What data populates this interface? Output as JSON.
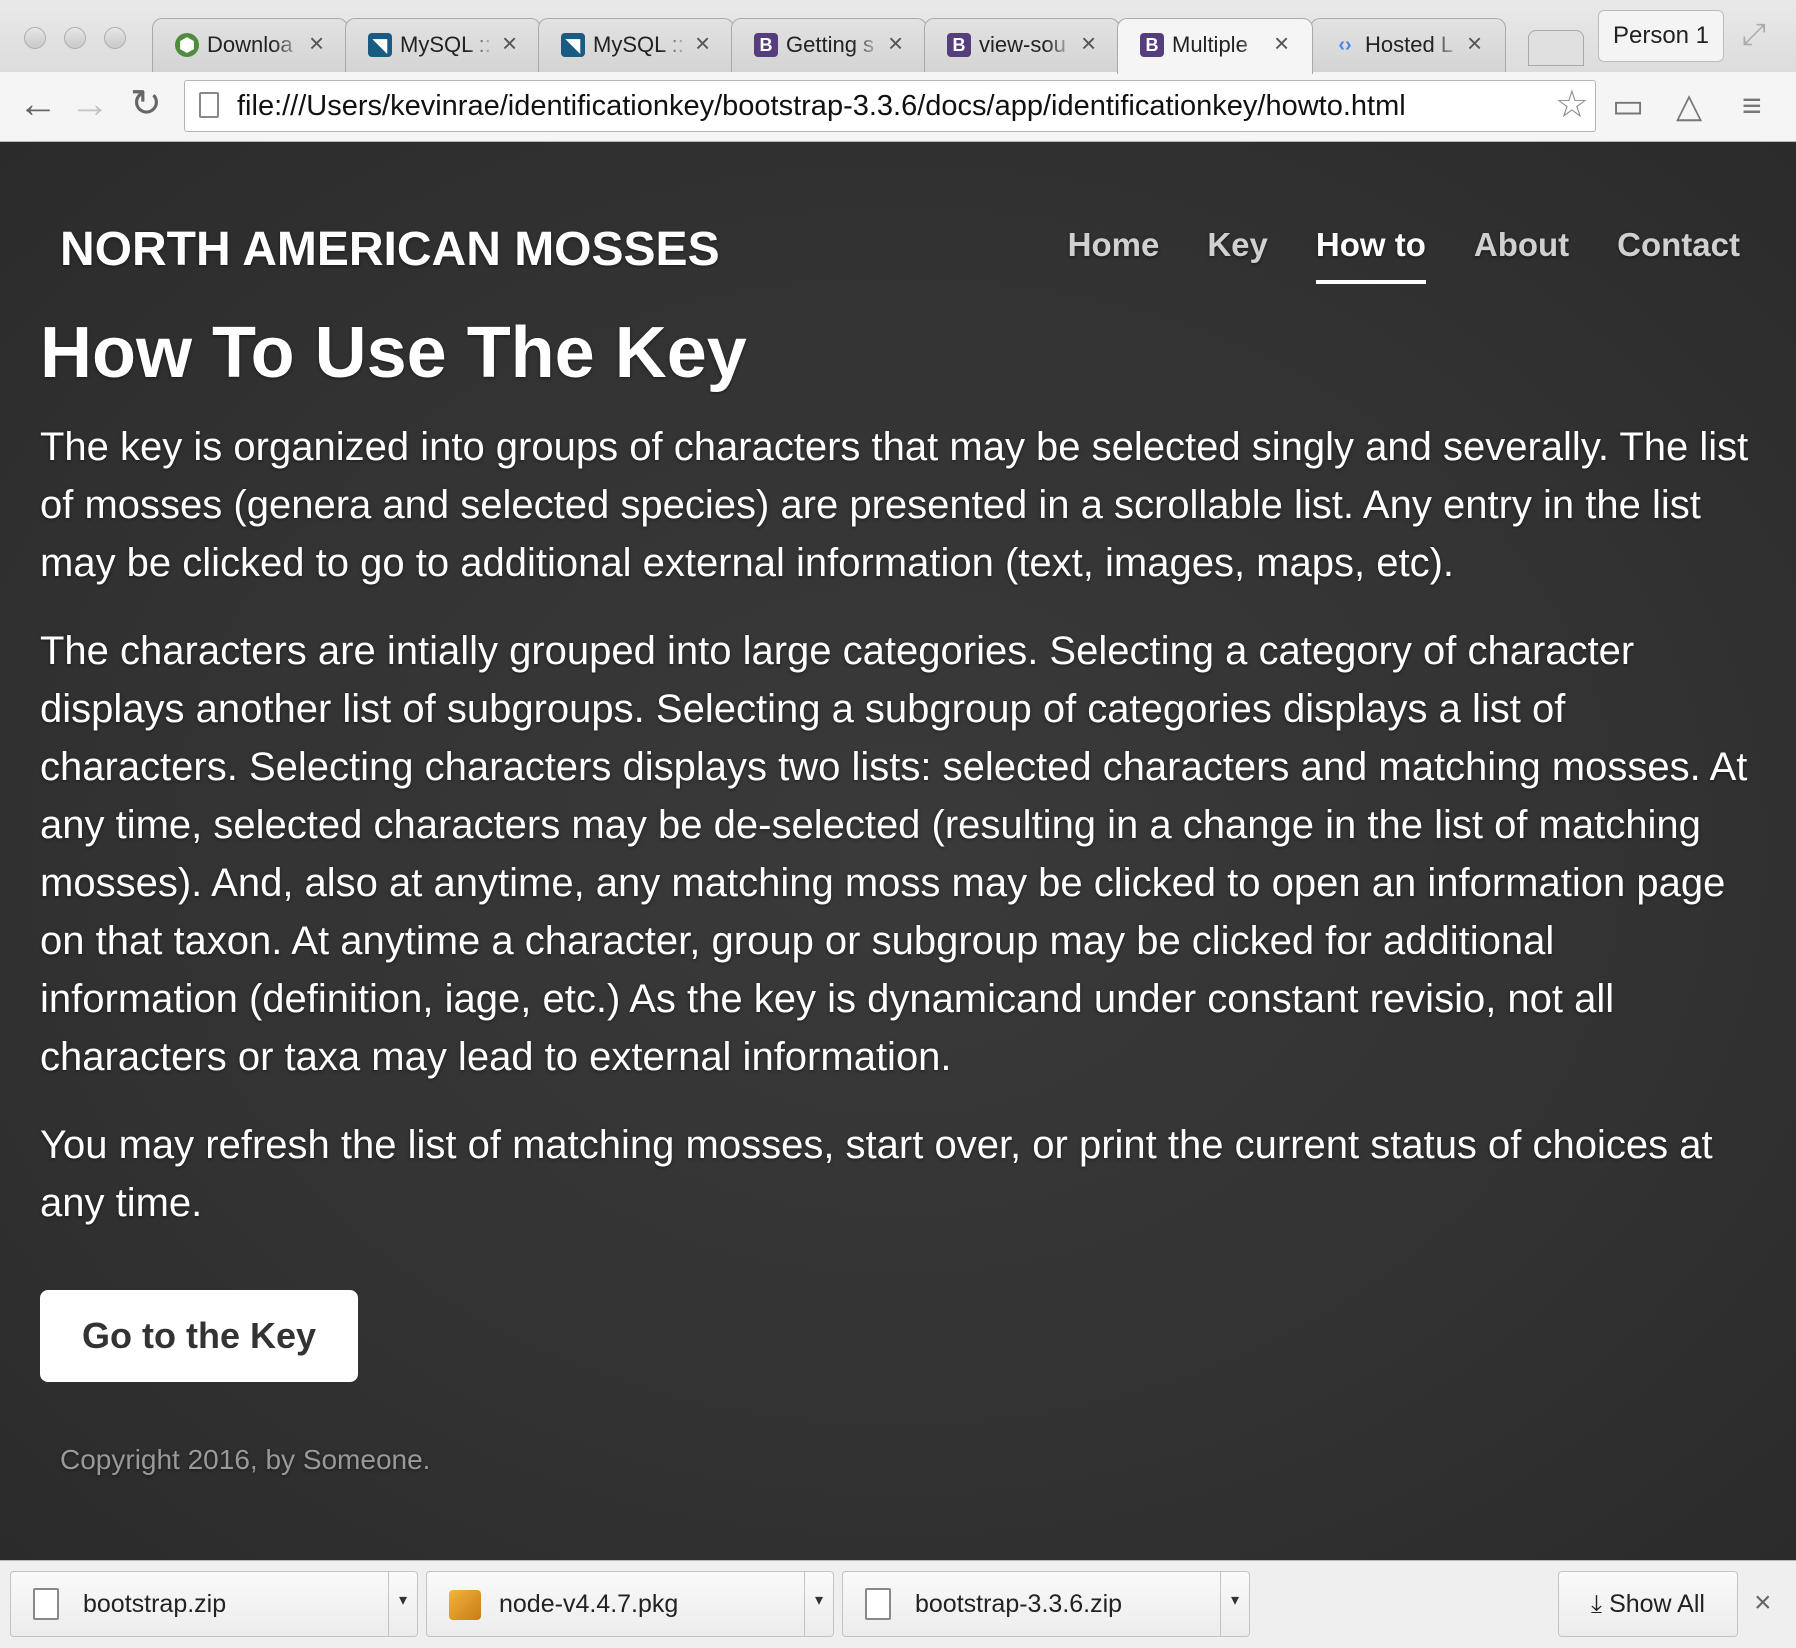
{
  "browser": {
    "tabs": [
      {
        "title": "Downloa",
        "favicon": "node-hexagon-icon",
        "color": "#4e8d3a"
      },
      {
        "title": "MySQL ::",
        "favicon": "mysql-dolphin-icon",
        "color": "#1a5b82"
      },
      {
        "title": "MySQL ::",
        "favicon": "mysql-dolphin-icon",
        "color": "#1a5b82"
      },
      {
        "title": "Getting s",
        "favicon": "bootstrap-b-icon",
        "color": "#563d7c"
      },
      {
        "title": "view-sou",
        "favicon": "bootstrap-b-icon",
        "color": "#563d7c"
      },
      {
        "title": "Multiple",
        "favicon": "bootstrap-b-icon",
        "color": "#563d7c"
      },
      {
        "title": "Hosted L",
        "favicon": "google-brackets-icon",
        "color": "#4285f4"
      }
    ],
    "active_tab_index": 5,
    "profile_label": "Person 1",
    "url": "file:///Users/kevinrae/identificationkey/bootstrap-3.3.6/docs/app/identificationkey/howto.html"
  },
  "site": {
    "brand": "NORTH AMERICAN MOSSES",
    "nav": [
      {
        "label": "Home"
      },
      {
        "label": "Key"
      },
      {
        "label": "How to",
        "active": true
      },
      {
        "label": "About"
      },
      {
        "label": "Contact"
      }
    ]
  },
  "main": {
    "title": "How To Use The Key",
    "paragraphs": [
      "The key is organized into groups of characters that may be selected singly and severally. The list of mosses (genera and selected species) are presented in a scrollable list. Any entry in the list may be clicked to go to additional external information (text, images, maps, etc).",
      "The characters are intially grouped into large categories. Selecting a category of character displays another list of subgroups. Selecting a subgroup of categories displays a list of characters. Selecting characters displays two lists: selected characters and matching mosses. At any time, selected characters may be de-selected (resulting in a change in the list of matching mosses). And, also at anytime, any matching moss may be clicked to open an information page on that taxon. At anytime a character, group or subgroup may be clicked for additional information (definition, iage, etc.) As the key is dynamicand under constant revisio, not all characters or taxa may lead to external information.",
      "You may refresh the list of matching mosses, start over, or print the current status of choices at any time."
    ],
    "cta_label": "Go to the Key",
    "copyright": "Copyright 2016, by Someone."
  },
  "downloads": {
    "items": [
      {
        "name": "bootstrap.zip",
        "icon": "zip-file-icon"
      },
      {
        "name": "node-v4.4.7.pkg",
        "icon": "package-icon"
      },
      {
        "name": "bootstrap-3.3.6.zip",
        "icon": "zip-file-icon"
      }
    ],
    "show_all_label": "Show All"
  },
  "colors": {
    "page_background": "#333333",
    "cta_background": "#ffffff",
    "bootstrap_purple": "#563d7c"
  }
}
